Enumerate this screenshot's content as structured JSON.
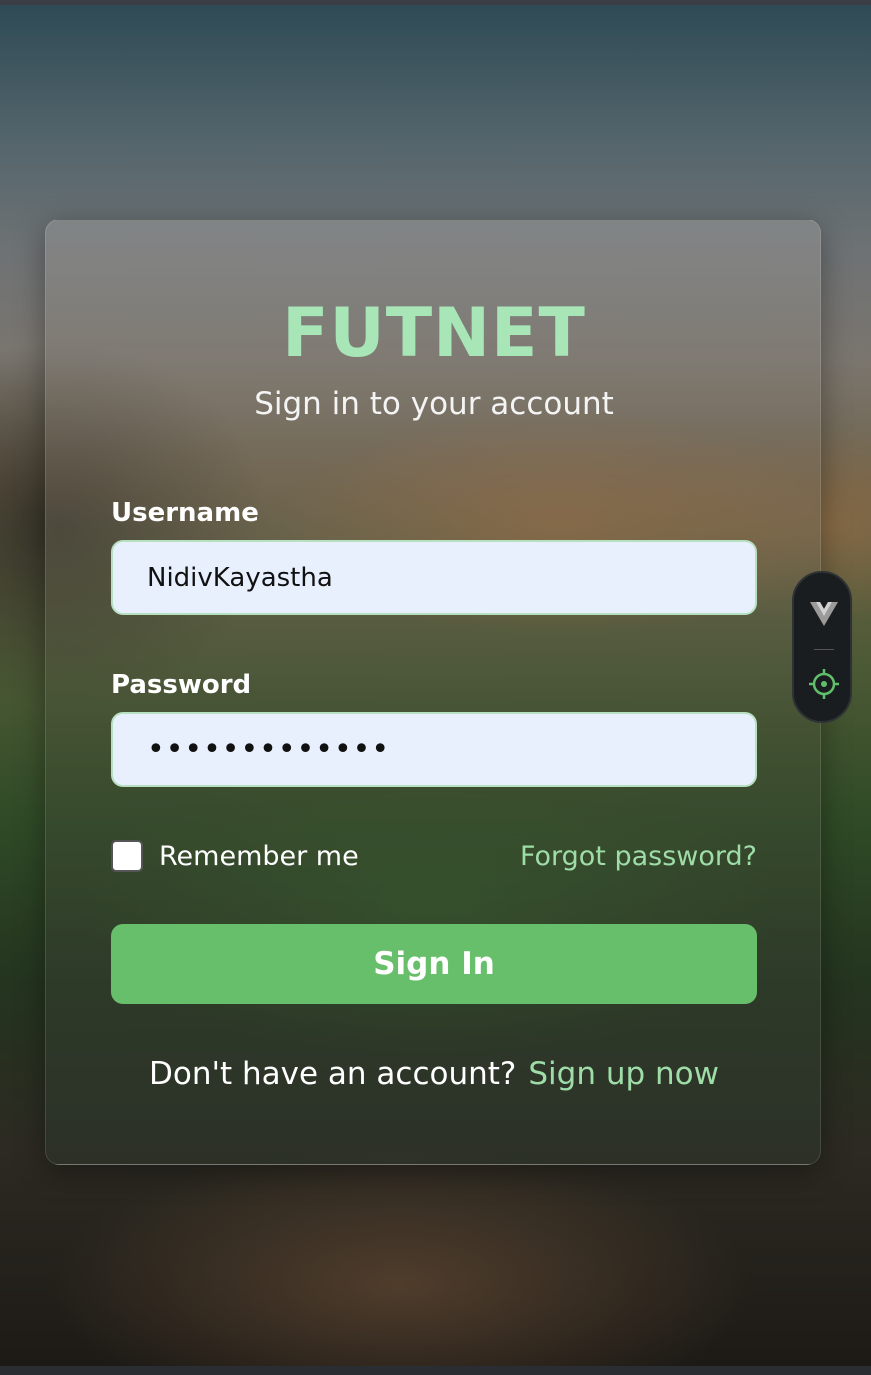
{
  "brand": {
    "name": "FUTNET",
    "accent_color": "#a8e6b8"
  },
  "subtitle": "Sign in to your account",
  "form": {
    "username_label": "Username",
    "username_value": "NidivKayastha",
    "password_label": "Password",
    "password_value": "•••••••••••••",
    "remember_label": "Remember me",
    "remember_checked": false,
    "forgot_label": "Forgot password?",
    "submit_label": "Sign In",
    "submit_color": "#68bf6b"
  },
  "footer": {
    "prompt": "Don't have an account?",
    "signup_label": "Sign up now",
    "link_color": "#9fdda8"
  },
  "dev_widget": {
    "icons": [
      "vue-devtools-logo-icon",
      "inspect-target-icon"
    ]
  }
}
